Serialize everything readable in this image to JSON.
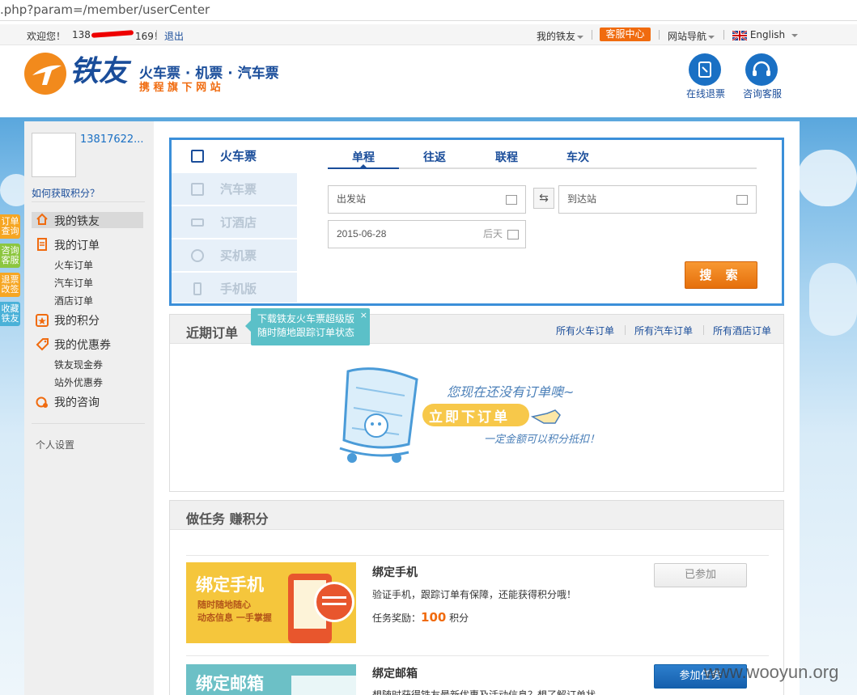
{
  "url": ".php?param=/member/userCenter",
  "topbar": {
    "welcome": "欢迎您！",
    "phone": "138",
    "phone_tail": "169！",
    "logout": "退出",
    "my_tieyou": "我的铁友",
    "service_center": "客服中心",
    "site_nav": "网站导航",
    "language": "English"
  },
  "header": {
    "logo_text": "铁友",
    "slogan": "火车票 · 机票 · 汽车票",
    "subslogan": "携 程 旗 下 网 站",
    "refund_label": "在线退票",
    "support_label": "咨询客服"
  },
  "colors": {
    "accent_blue": "#1a4d9a",
    "border_blue": "#3b8fd9",
    "orange": "#f06b0f",
    "teal": "#5bc0c8"
  },
  "sidebar": {
    "username": "13817622...",
    "points_help": "如何获取积分？",
    "menu": [
      {
        "label": "我的铁友",
        "icon": "home-icon",
        "active": true
      },
      {
        "label": "我的订单",
        "icon": "order-icon"
      },
      {
        "label": "火车订单",
        "sub": true
      },
      {
        "label": "汽车订单",
        "sub": true
      },
      {
        "label": "酒店订单",
        "sub": true
      },
      {
        "label": "我的积分",
        "icon": "star-icon"
      },
      {
        "label": "我的优惠券",
        "icon": "coupon-icon"
      },
      {
        "label": "铁友现金券",
        "sub": true
      },
      {
        "label": "站外优惠券",
        "sub": true
      },
      {
        "label": "我的咨询",
        "icon": "chat-icon"
      }
    ],
    "settings": "个人设置"
  },
  "floatbar": [
    "订单查询",
    "咨询客服",
    "退票改签",
    "收藏铁友"
  ],
  "search": {
    "vtabs": [
      {
        "label": "火车票",
        "icon": "train-icon",
        "active": true
      },
      {
        "label": "汽车票",
        "icon": "bus-icon"
      },
      {
        "label": "订酒店",
        "icon": "bed-icon"
      },
      {
        "label": "买机票",
        "icon": "plane-icon"
      },
      {
        "label": "手机版",
        "icon": "phone-icon"
      }
    ],
    "htabs": [
      "单程",
      "往返",
      "联程",
      "车次"
    ],
    "from_placeholder": "出发站",
    "to_placeholder": "到达站",
    "date": "2015-06-28",
    "date_hint": "后天",
    "search_button": "搜 索"
  },
  "recent": {
    "title": "近期订单",
    "links": [
      "所有火车订单",
      "所有汽车订单",
      "所有酒店订单"
    ],
    "tip_line1": "下载铁友火车票超级版",
    "tip_line2": "随时随地跟踪订单状态",
    "empty_text": "您现在还没有订单噢~",
    "empty_cta": "立即下订单",
    "empty_note": "一定金额可以积分抵扣！"
  },
  "tasks": {
    "title": "做任务 赚积分",
    "items": [
      {
        "banner_title": "绑定手机",
        "banner_line1": "随时随地随心",
        "banner_line2": "动态信息 一手掌握",
        "title": "绑定手机",
        "desc": "验证手机，跟踪订单有保障，还能获得积分哦！",
        "reward_label": "任务奖励：",
        "reward_value": "100",
        "reward_unit": "积分",
        "button": "已参加"
      },
      {
        "banner_title": "绑定邮箱",
        "title": "绑定邮箱",
        "desc": "想随时获得铁友最新优惠及活动信息？想了解订单状",
        "button": "参加任务"
      }
    ]
  },
  "watermark": "www.wooyun.org"
}
